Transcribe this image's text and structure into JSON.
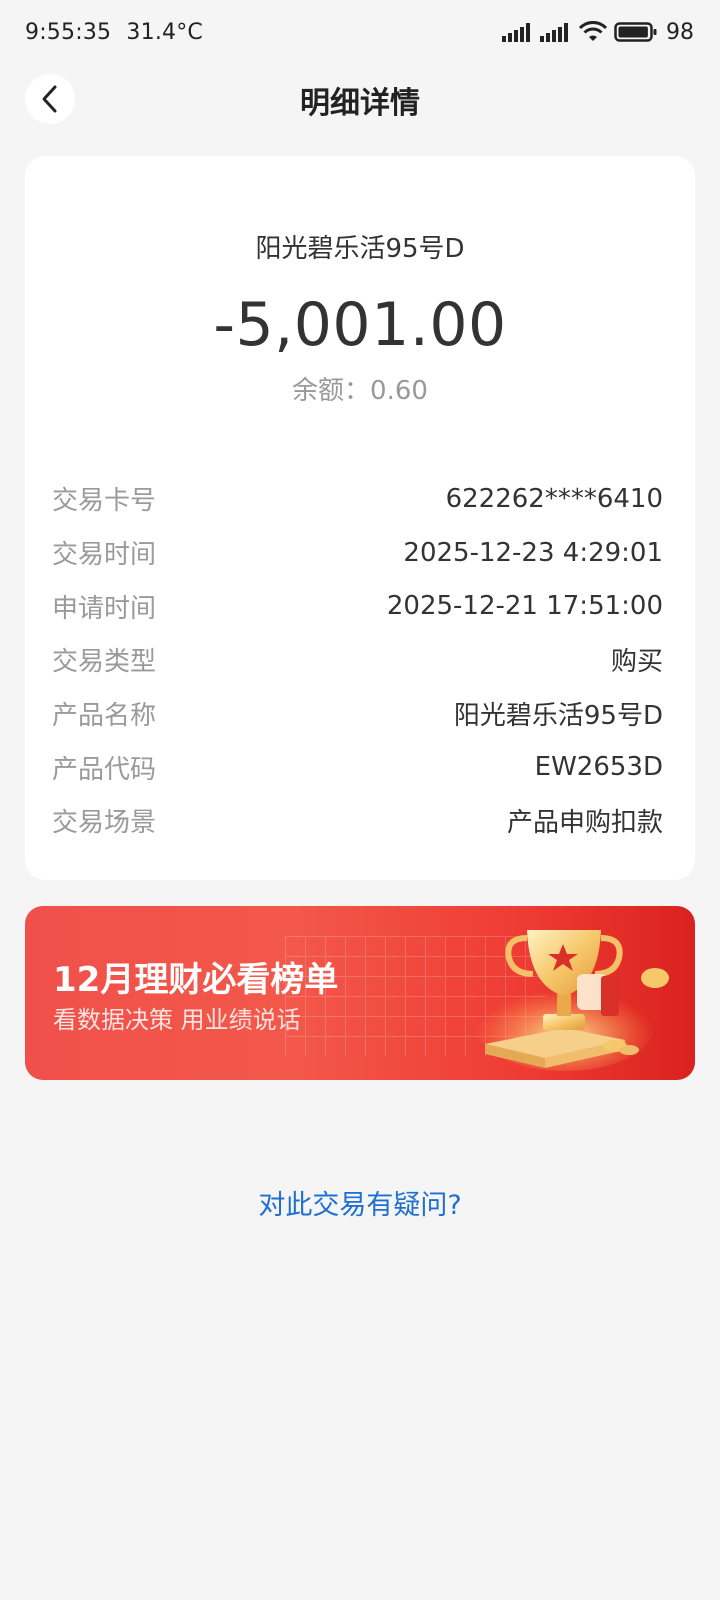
{
  "status_bar": {
    "time": "9:55:35",
    "temperature": "31.4°C",
    "battery": "98",
    "battery_level": 0.98
  },
  "header": {
    "title": "明细详情",
    "back_icon": "chevron-left-icon"
  },
  "detail": {
    "product_title": "阳光碧乐活95号D",
    "amount": "-5,001.00",
    "balance": "余额：0.60",
    "rows": [
      {
        "label": "交易卡号",
        "value": "622262****6410"
      },
      {
        "label": "交易时间",
        "value": "2025-12-23 4:29:01"
      },
      {
        "label": "申请时间",
        "value": "2025-12-21 17:51:00"
      },
      {
        "label": "交易类型",
        "value": "购买"
      },
      {
        "label": "产品名称",
        "value": "阳光碧乐活95号D"
      },
      {
        "label": "产品代码",
        "value": "EW2653D"
      },
      {
        "label": "交易场景",
        "value": "产品申购扣款"
      }
    ]
  },
  "banner": {
    "title": "12月理财必看榜单",
    "subtitle": "看数据决策 用业绩说话",
    "image_icon": "trophy-icon"
  },
  "question_link": "对此交易有疑问?",
  "colors": {
    "background": "#f5f5f5",
    "link": "#1f6fd1",
    "banner_red": "#ee3b33"
  }
}
